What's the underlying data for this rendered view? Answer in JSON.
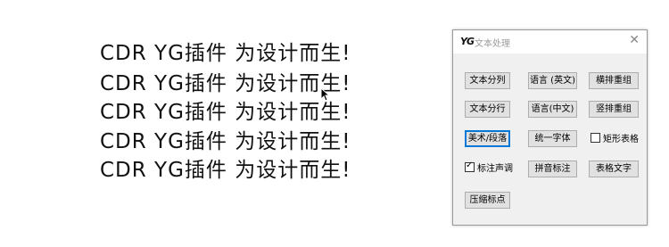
{
  "background_text": {
    "lines": [
      "CDR YG插件 为设计而生!",
      "CDR YG插件 为设计而生!",
      "CDR YG插件 为设计而生!",
      "CDR YG插件 为设计而生!",
      "CDR YG插件 为设计而生!"
    ]
  },
  "panel": {
    "logo": "YG",
    "title": "文本处理",
    "close_glyph": "✕",
    "buttons": {
      "split_text": "文本分列",
      "language_en": "语言 (英文)",
      "horizontal_regroup": "横排重组",
      "split_lines": "文本分行",
      "language_cn": "语言(中文)",
      "vertical_regroup": "竖排重组",
      "art_paragraph": "美术/段落",
      "unify_font": "统一字体",
      "pinyin_annotation": "拼音标注",
      "table_text": "表格文字",
      "compress_punctuation": "压缩标点"
    },
    "checkboxes": {
      "rect_table": {
        "label": "矩形表格",
        "checked": false
      },
      "annotate_tone": {
        "label": "标注声调",
        "checked": true
      }
    }
  },
  "colors": {
    "panel_bg": "#f0f0f0",
    "button_bg": "#e1e1e1",
    "focus_border": "#0078d7",
    "title_text": "#9a9a9a"
  },
  "icons": {
    "cursor": "mouse-pointer-icon",
    "close": "close-icon",
    "check": "checkmark-icon"
  }
}
